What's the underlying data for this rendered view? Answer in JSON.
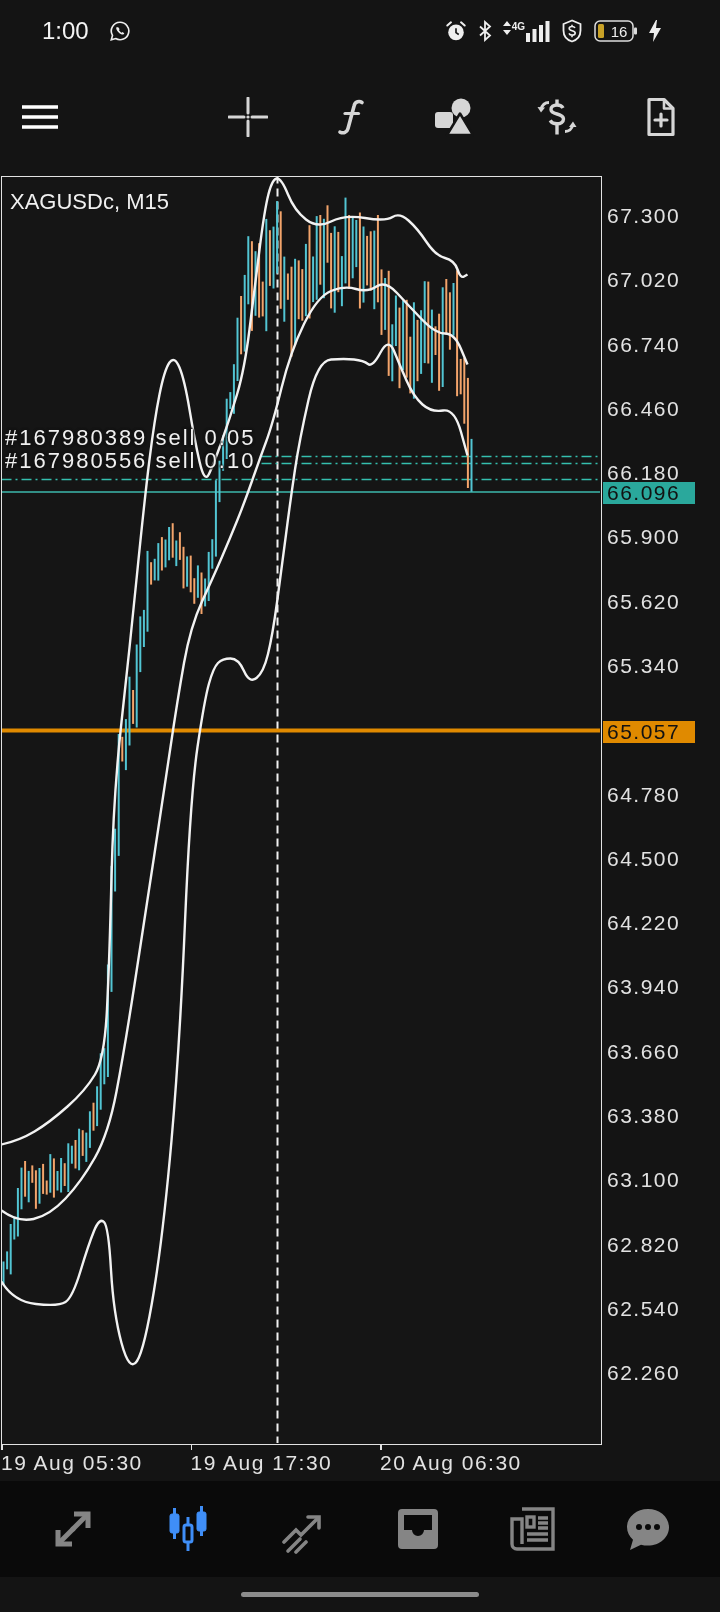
{
  "status_bar": {
    "time": "1:00",
    "network_type": "4G",
    "battery": "16"
  },
  "chart": {
    "title": "XAGUSDc, M15",
    "orders": [
      {
        "label": "#167980389 sell 0.05"
      },
      {
        "label": "#167980556 sell 0.10"
      }
    ],
    "price_markers": [
      {
        "kind": "bid",
        "label": "66.096"
      },
      {
        "kind": "level",
        "label": "65.057"
      }
    ],
    "price_ticks": [
      "67.300",
      "67.020",
      "66.740",
      "66.460",
      "66.180",
      "65.900",
      "65.620",
      "65.340",
      "64.780",
      "64.500",
      "64.220",
      "63.940",
      "63.660",
      "63.380",
      "63.100",
      "62.820",
      "62.540",
      "62.260"
    ],
    "time_ticks": [
      "19 Aug 05:30",
      "19 Aug 17:30",
      "20 Aug 06:30"
    ]
  },
  "bottom_nav": {
    "tabs": [
      {
        "selected": false
      },
      {
        "selected": true
      },
      {
        "selected": false
      },
      {
        "selected": false
      },
      {
        "selected": false
      },
      {
        "selected": false
      }
    ]
  }
}
